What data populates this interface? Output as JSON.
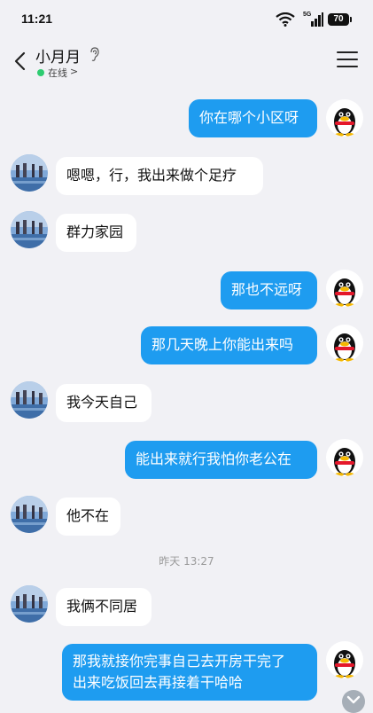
{
  "status_bar": {
    "time": "11:21",
    "signal_label": "5G",
    "battery": "70"
  },
  "header": {
    "contact_name": "小月月",
    "status": "在线",
    "status_chevron": ">"
  },
  "messages": [
    {
      "side": "out",
      "text": "你在哪个小区呀"
    },
    {
      "side": "in",
      "text": "嗯嗯，行，我出来做个足疗"
    },
    {
      "side": "in",
      "text": "群力家园"
    },
    {
      "side": "out",
      "text": "那也不远呀"
    },
    {
      "side": "out",
      "text": "那几天晚上你能出来吗"
    },
    {
      "side": "in",
      "text": "我今天自己"
    },
    {
      "side": "out",
      "text": "能出来就行我怕你老公在"
    },
    {
      "side": "in",
      "text": "他不在"
    },
    {
      "side": "time",
      "text": "昨天 13:27"
    },
    {
      "side": "in",
      "text": "我俩不同居"
    },
    {
      "side": "out",
      "text": "那我就接你完事自己去开房干完了\n出来吃饭回去再接着干哈哈"
    }
  ],
  "colors": {
    "outgoing_bubble": "#1e9cf0",
    "incoming_bubble": "#ffffff",
    "background": "#f1f1f5",
    "online_dot": "#2ecc71"
  },
  "icons": [
    "back-arrow-icon",
    "ear-icon",
    "menu-icon",
    "wifi-icon",
    "signal-icon",
    "battery-icon",
    "penguin-avatar-icon",
    "chevron-down-icon"
  ]
}
